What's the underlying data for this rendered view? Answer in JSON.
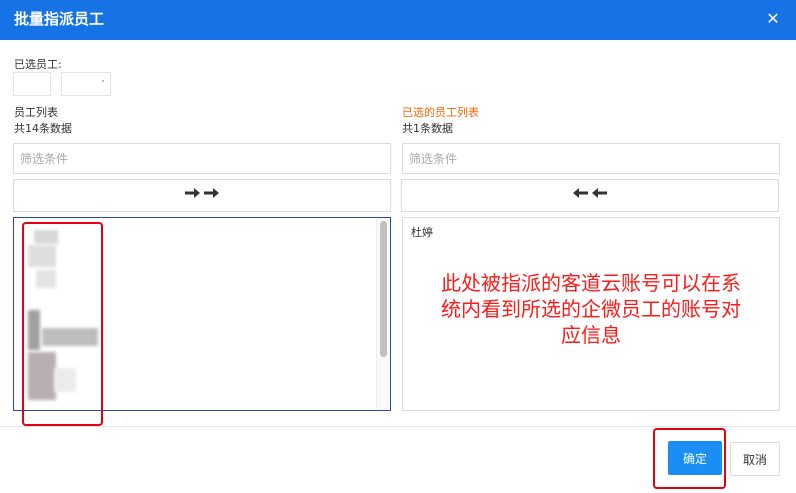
{
  "dialog": {
    "title": "批量指派员工",
    "close_icon": "close-icon",
    "close_glyph": "✕"
  },
  "selected": {
    "label": "已选员工:"
  },
  "left_panel": {
    "title": "员工列表",
    "count_text": "共14条数据",
    "filter_placeholder": "筛选条件",
    "move_arrows": "➜➜",
    "move_icon": "arrow-right-double-icon"
  },
  "right_panel": {
    "title": "已选的员工列表",
    "count_text": "共1条数据",
    "filter_placeholder": "筛选条件",
    "move_arrows": "🡐🡐",
    "move_icon": "arrow-left-double-icon",
    "items": [
      "杜婷"
    ]
  },
  "annotation": {
    "text": "此处被指派的客道云账号可以在系统内看到所选的企微员工的账号对应信息",
    "color": "#ff1a1a"
  },
  "footer": {
    "confirm_label": "确定",
    "cancel_label": "取消"
  },
  "colors": {
    "header": "#1673e6",
    "primary_button": "#1a8ef5",
    "accent_orange": "#ff6600",
    "highlight_red": "#e60012"
  }
}
